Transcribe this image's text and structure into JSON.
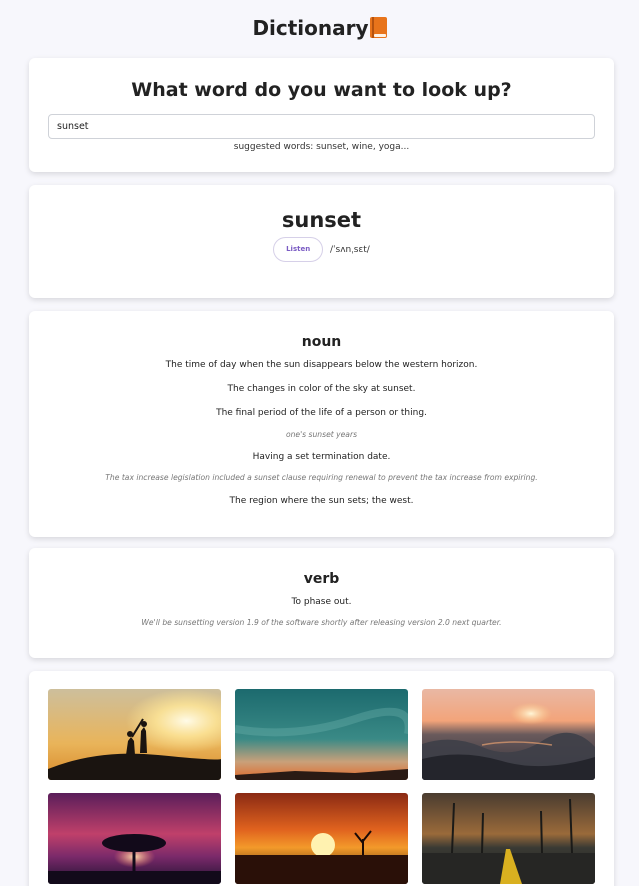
{
  "header": {
    "title": "Dictionary",
    "icon": "book-icon"
  },
  "search": {
    "heading": "What word do you want to look up?",
    "value": "sunset",
    "suggestions": "suggested words: sunset, wine, yoga..."
  },
  "word": {
    "text": "sunset",
    "listen_label": "Listen",
    "phonetic": "/ˈsʌnˌsɛt/"
  },
  "meanings": [
    {
      "part_of_speech": "noun",
      "definitions": [
        {
          "definition": "The time of day when the sun disappears below the western horizon."
        },
        {
          "definition": "The changes in color of the sky at sunset."
        },
        {
          "definition": "The final period of the life of a person or thing.",
          "example": "one's sunset years"
        },
        {
          "definition": "Having a set termination date.",
          "example": "The tax increase legislation included a sunset clause requiring renewal to prevent the tax increase from expiring."
        },
        {
          "definition": "The region where the sun sets; the west."
        }
      ]
    },
    {
      "part_of_speech": "verb",
      "definitions": [
        {
          "definition": "To phase out.",
          "example": "We'll be sunsetting version 1.9 of the software shortly after releasing version 2.0 next quarter."
        }
      ]
    }
  ],
  "images": [
    {
      "subject": "couple silhouette at sunset",
      "sky_top": "#d9c8a0",
      "sky_bottom": "#e8a040"
    },
    {
      "subject": "teal sky over dark horizon",
      "sky_top": "#1f6f72",
      "sky_bottom": "#e07a3a"
    },
    {
      "subject": "ocean waves at sunset",
      "sky_top": "#e8b29a",
      "sky_bottom": "#3a3a44"
    },
    {
      "subject": "tree under purple sky",
      "sky_top": "#7a2a6a",
      "sky_bottom": "#e04a6a"
    },
    {
      "subject": "orange sun with tree silhouette",
      "sky_top": "#b8401a",
      "sky_bottom": "#f0a030"
    },
    {
      "subject": "palm tree lined road",
      "sky_top": "#6a5a4a",
      "sky_bottom": "#2a2a26"
    }
  ]
}
